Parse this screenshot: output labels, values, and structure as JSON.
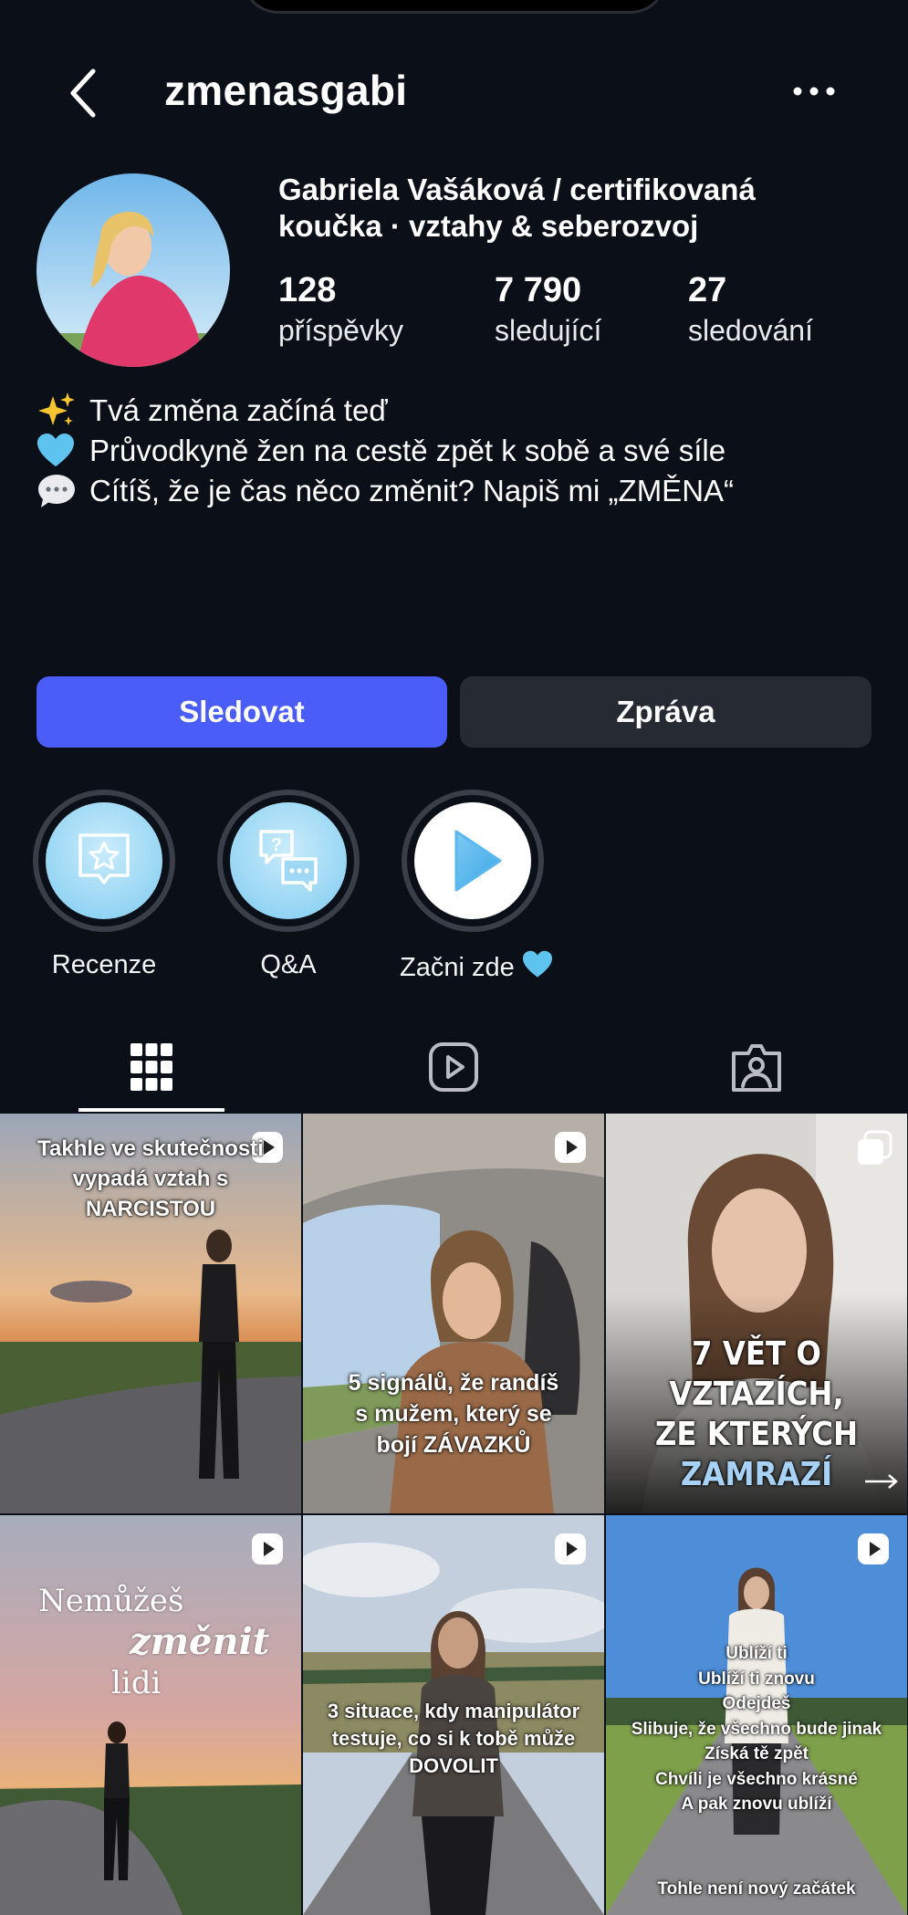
{
  "header": {
    "username": "zmenasgabi"
  },
  "profile": {
    "name_line1": "Gabriela Vašáková / certifikovaná",
    "name_line2": "koučka · vztahy & seberozvoj",
    "stats": [
      {
        "value": "128",
        "label": "příspěvky"
      },
      {
        "value": "7 790",
        "label": "sledující"
      },
      {
        "value": "27",
        "label": "sledování"
      }
    ]
  },
  "bio": [
    {
      "icon": "sparkles-icon",
      "text": "Tvá změna začíná teď"
    },
    {
      "icon": "blue-heart-icon",
      "text": "Průvodkyně žen na cestě zpět k sobě a své síle"
    },
    {
      "icon": "speech-bubble-icon",
      "text": "Cítíš, že je čas něco změnit? Napiš mi „ZMĚNA“"
    }
  ],
  "actions": {
    "follow": "Sledovat",
    "message": "Zpráva"
  },
  "highlights": [
    {
      "label": "Recenze",
      "icon": "star-bubble-icon"
    },
    {
      "label": "Q&A",
      "icon": "question-chat-icon"
    },
    {
      "label": "Začni zde",
      "icon": "play-icon",
      "label_emoji": "blue-heart-icon"
    }
  ],
  "tabs": [
    {
      "name": "grid-icon",
      "active": true
    },
    {
      "name": "reels-icon",
      "active": false
    },
    {
      "name": "tagged-icon",
      "active": false
    }
  ],
  "posts": [
    {
      "type": "reel",
      "lines": [
        "Takhle ve skutečnosti",
        "vypadá vztah s",
        "NARCISTOU"
      ]
    },
    {
      "type": "reel",
      "lines": [
        "5 signálů, že randíš",
        "s mužem, který se",
        "bojí ZÁVAZKŮ"
      ]
    },
    {
      "type": "carousel",
      "lines": [
        "7 VĚT O VZTAZÍCH,",
        "ZE KTERÝCH",
        "ZAMRAZÍ"
      ]
    },
    {
      "type": "reel",
      "lines": [
        "Nemůžeš",
        "změnit",
        "lidi"
      ]
    },
    {
      "type": "reel",
      "lines": [
        "3 situace, kdy manipulátor",
        "testuje, co si k tobě může",
        "DOVOLIT"
      ]
    },
    {
      "type": "reel",
      "lines": [
        "Ublíží ti",
        "Ublíží ti znovu",
        "Odejdeš",
        "Slibuje, že všechno bude jinak",
        "Získá tě zpět",
        "Chvíli je všechno krásné",
        "A pak znovu ublíží",
        "Tohle není nový začátek"
      ]
    }
  ],
  "colors": {
    "accent": "#4a5df9",
    "background": "#0b0f17",
    "secondary_button": "#262a33"
  }
}
